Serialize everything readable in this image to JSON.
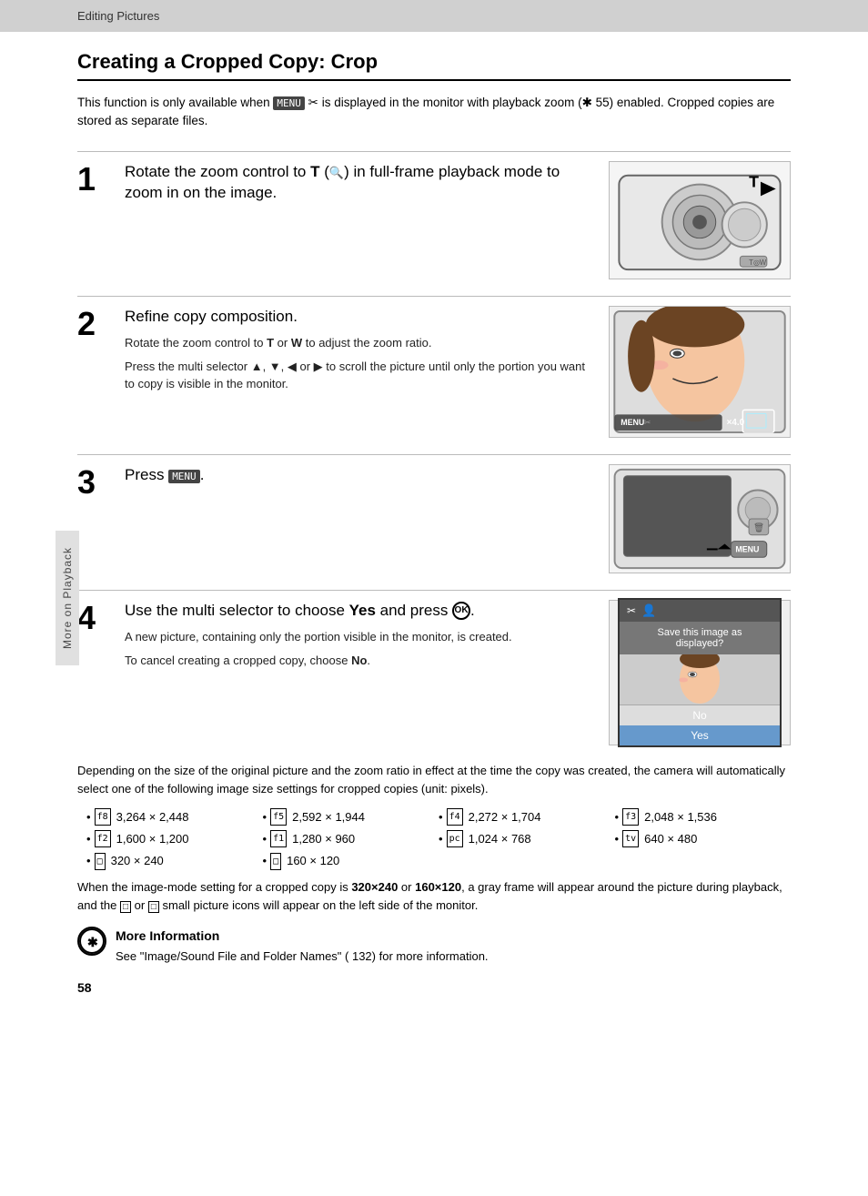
{
  "topbar": {
    "label": "Editing Pictures"
  },
  "page": {
    "title": "Creating a Cropped Copy: Crop",
    "intro": "This function is only available when  is displayed in the monitor with playback zoom ( 55) enabled. Cropped copies are stored as separate files.",
    "steps": [
      {
        "number": "1",
        "heading": "Rotate the zoom control to T (🔍) in full-frame playback mode to zoom in on the image.",
        "detail": ""
      },
      {
        "number": "2",
        "heading": "Refine copy composition.",
        "detail1": "Rotate the zoom control to T or W to adjust the zoom ratio.",
        "detail2": "Press the multi selector ▲, ▼, ◀ or ▶ to scroll the picture until only the portion you want to copy is visible in the monitor."
      },
      {
        "number": "3",
        "heading": "Press MENU.",
        "detail": ""
      },
      {
        "number": "4",
        "heading": "Use the multi selector to choose Yes and press 🆗.",
        "detail1": "A new picture, containing only the portion visible in the monitor, is created.",
        "detail2": "To cancel creating a cropped copy, choose No."
      }
    ],
    "footer1": "Depending on the size of the original picture and the zoom ratio in effect at the time the copy was created, the camera will automatically select one of the following image size settings for cropped copies (unit: pixels).",
    "bullets": [
      "🔲 3,264 × 2,448",
      "🔲 2,592 × 1,944",
      "🔲 2,272 × 1,704",
      "🔲 2,048 × 1,536",
      "🔲 1,600 × 1,200",
      "🔲 1,280 × 960",
      "🔲 1,024 × 768",
      "🔲 640 × 480",
      "🔲 320 × 240",
      "🔲 160 × 120"
    ],
    "bullets_raw": [
      {
        "icon": "f8",
        "text": "3,264 × 2,448"
      },
      {
        "icon": "f5",
        "text": "2,592 × 1,944"
      },
      {
        "icon": "f4",
        "text": "2,272 × 1,704"
      },
      {
        "icon": "f3",
        "text": "2,048 × 1,536"
      },
      {
        "icon": "f2",
        "text": "1,600 × 1,200"
      },
      {
        "icon": "f1",
        "text": "1,280 × 960"
      },
      {
        "icon": "pc",
        "text": "1,024 × 768"
      },
      {
        "icon": "tv",
        "text": "640 × 480"
      },
      {
        "icon": "sq",
        "text": "320 × 240"
      },
      {
        "icon": "sq",
        "text": "160 × 120"
      }
    ],
    "footnote": "When the image-mode setting for a cropped copy is 320×240 or 160×120, a gray frame will appear around the picture during playback, and the  or  small picture icons will appear on the left side of the monitor.",
    "more_info_title": "More Information",
    "more_info_body": "See \"Image/Sound File and Folder Names\" ( 132) for more information.",
    "page_number": "58"
  },
  "sidebar": {
    "label": "More on Playback"
  }
}
